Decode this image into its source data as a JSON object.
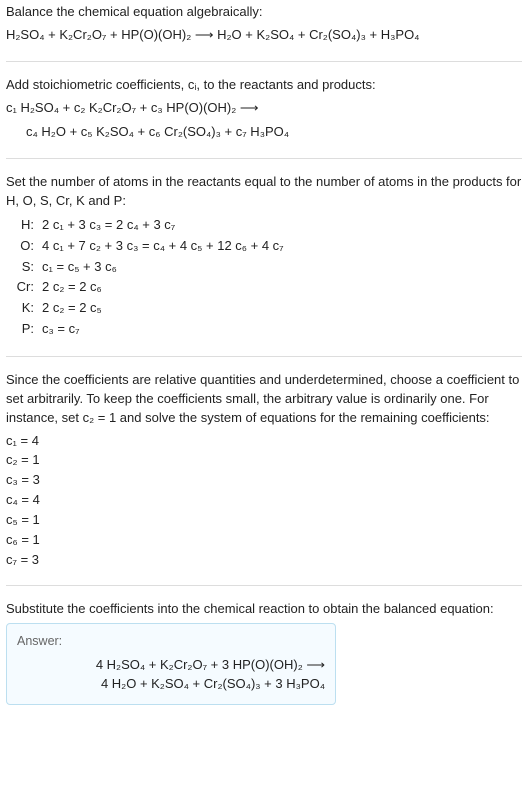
{
  "intro": "Balance the chemical equation algebraically:",
  "eq_unbalanced": "H₂SO₄ + K₂Cr₂O₇ + HP(O)(OH)₂  ⟶  H₂O + K₂SO₄ + Cr₂(SO₄)₃ + H₃PO₄",
  "stoich_intro": "Add stoichiometric coefficients, cᵢ, to the reactants and products:",
  "stoich_line1": "c₁ H₂SO₄ + c₂ K₂Cr₂O₇ + c₃ HP(O)(OH)₂  ⟶",
  "stoich_line2": "c₄ H₂O + c₅ K₂SO₄ + c₆ Cr₂(SO₄)₃ + c₇ H₃PO₄",
  "atoms_intro": "Set the number of atoms in the reactants equal to the number of atoms in the products for H, O, S, Cr, K and P:",
  "atoms": [
    {
      "label": "H:",
      "eq": "2 c₁ + 3 c₃ = 2 c₄ + 3 c₇"
    },
    {
      "label": "O:",
      "eq": "4 c₁ + 7 c₂ + 3 c₃ = c₄ + 4 c₅ + 12 c₆ + 4 c₇"
    },
    {
      "label": "S:",
      "eq": "c₁ = c₅ + 3 c₆"
    },
    {
      "label": "Cr:",
      "eq": "2 c₂ = 2 c₆"
    },
    {
      "label": "K:",
      "eq": "2 c₂ = 2 c₅"
    },
    {
      "label": "P:",
      "eq": "c₃ = c₇"
    }
  ],
  "choose_text": "Since the coefficients are relative quantities and underdetermined, choose a coefficient to set arbitrarily. To keep the coefficients small, the arbitrary value is ordinarily one. For instance, set c₂ = 1 and solve the system of equations for the remaining coefficients:",
  "coeffs": [
    "c₁ = 4",
    "c₂ = 1",
    "c₃ = 3",
    "c₄ = 4",
    "c₅ = 1",
    "c₆ = 1",
    "c₇ = 3"
  ],
  "subst_text": "Substitute the coefficients into the chemical reaction to obtain the balanced equation:",
  "answer_label": "Answer:",
  "answer_line1": "4 H₂SO₄ + K₂Cr₂O₇ + 3 HP(O)(OH)₂  ⟶",
  "answer_line2": "4 H₂O + K₂SO₄ + Cr₂(SO₄)₃ + 3 H₃PO₄"
}
